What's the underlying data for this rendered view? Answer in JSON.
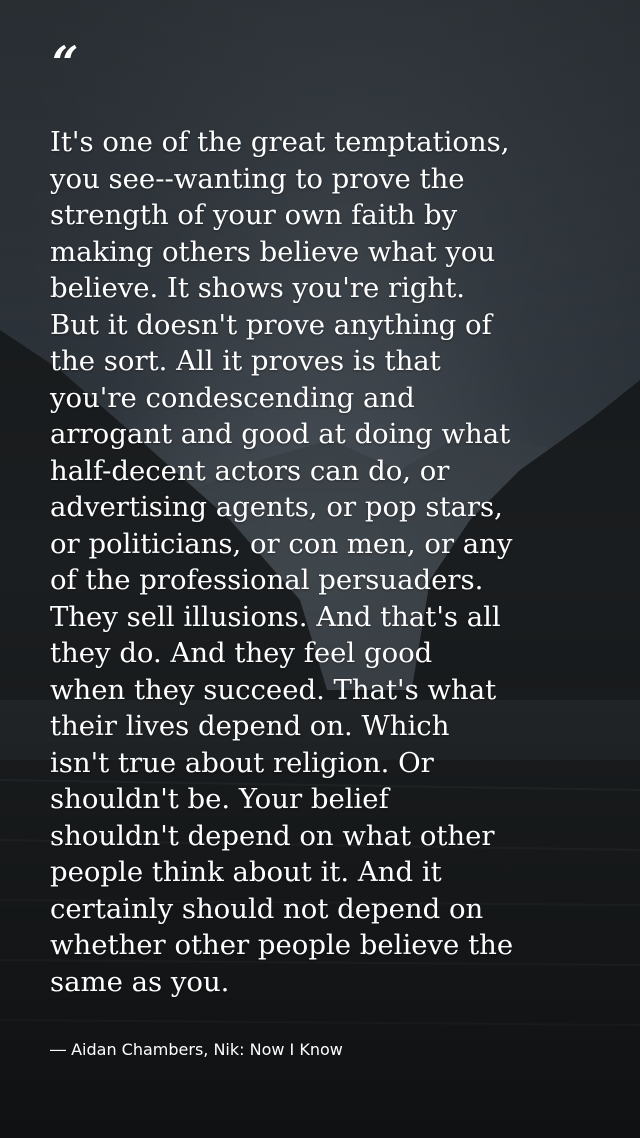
{
  "quote": {
    "mark": "“",
    "text": "It's one of the great temptations,\nyou see--wanting to prove the\nstrength of your own faith by\nmaking others believe what you\nbelieve. It shows you're right.\nBut it doesn't prove anything of\nthe sort. All it proves is that\nyou're condescending and\narrogant and good at doing what\nhalf-decent actors can do, or\nadvertising agents, or pop stars,\nor politicians, or con men, or any\nof the professional persuaders.\nThey sell illusions. And that's all\nthey do. And they feel good\nwhen they succeed. That's what\ntheir lives depend on. Which\nisn't true about religion. Or\nshouldn't be. Your belief\nshouldn't depend on what other\npeople think about it. And it\ncertainly should not depend on\nwhether other people believe the\nsame as you.",
    "attribution": "― Aidan Chambers, Nik: Now I Know"
  },
  "colors": {
    "text": "#ffffff",
    "sky_top": "#3a4148",
    "sky_bottom": "#22272b",
    "mountain": "#151719"
  }
}
